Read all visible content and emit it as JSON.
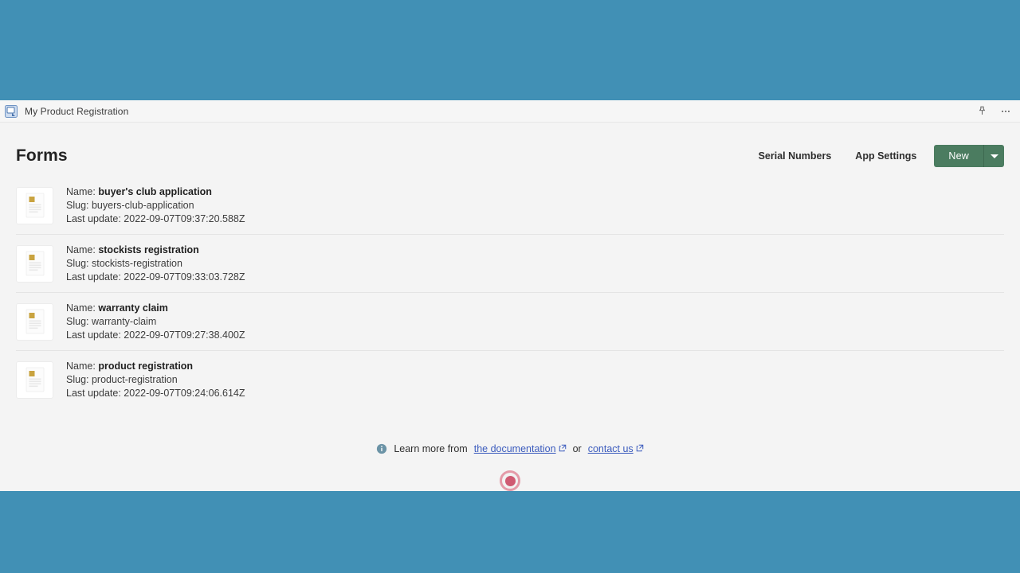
{
  "window": {
    "tab_title": "My Product Registration",
    "app_icon": "app-window-icon",
    "pin_icon": "pin-icon",
    "more_icon": "ellipsis-icon"
  },
  "header": {
    "title": "Forms",
    "links": [
      {
        "label": "Serial Numbers",
        "name": "serial-numbers-link"
      },
      {
        "label": "App Settings",
        "name": "app-settings-link"
      }
    ],
    "new_button": "New",
    "new_dropdown_icon": "chevron-down-icon"
  },
  "labels": {
    "name": "Name:",
    "slug": "Slug:",
    "last_update": "Last update:"
  },
  "forms": [
    {
      "name": "buyer's club application",
      "slug": "buyers-club-application",
      "last_update": "2022-09-07T09:37:20.588Z",
      "thumb_icon": "document-thumbnail-icon"
    },
    {
      "name": "stockists registration",
      "slug": "stockists-registration",
      "last_update": "2022-09-07T09:33:03.728Z",
      "thumb_icon": "document-thumbnail-icon"
    },
    {
      "name": "warranty claim",
      "slug": "warranty-claim",
      "last_update": "2022-09-07T09:27:38.400Z",
      "thumb_icon": "document-thumbnail-icon"
    },
    {
      "name": "product registration",
      "slug": "product-registration",
      "last_update": "2022-09-07T09:24:06.614Z",
      "thumb_icon": "document-thumbnail-icon"
    }
  ],
  "footer": {
    "info_icon": "info-icon",
    "text_before": "Learn more from",
    "doc_link": "the documentation",
    "text_between": "or",
    "contact_link": "contact us",
    "external_icon": "external-link-icon"
  },
  "record_indicator": {
    "icon": "record-indicator-icon"
  },
  "colors": {
    "desktop_background": "#4190b5",
    "primary_button": "#4b7c60",
    "link": "#3b5bbd",
    "record": "#cf5a72",
    "thumb_accent": "#c9a340"
  }
}
